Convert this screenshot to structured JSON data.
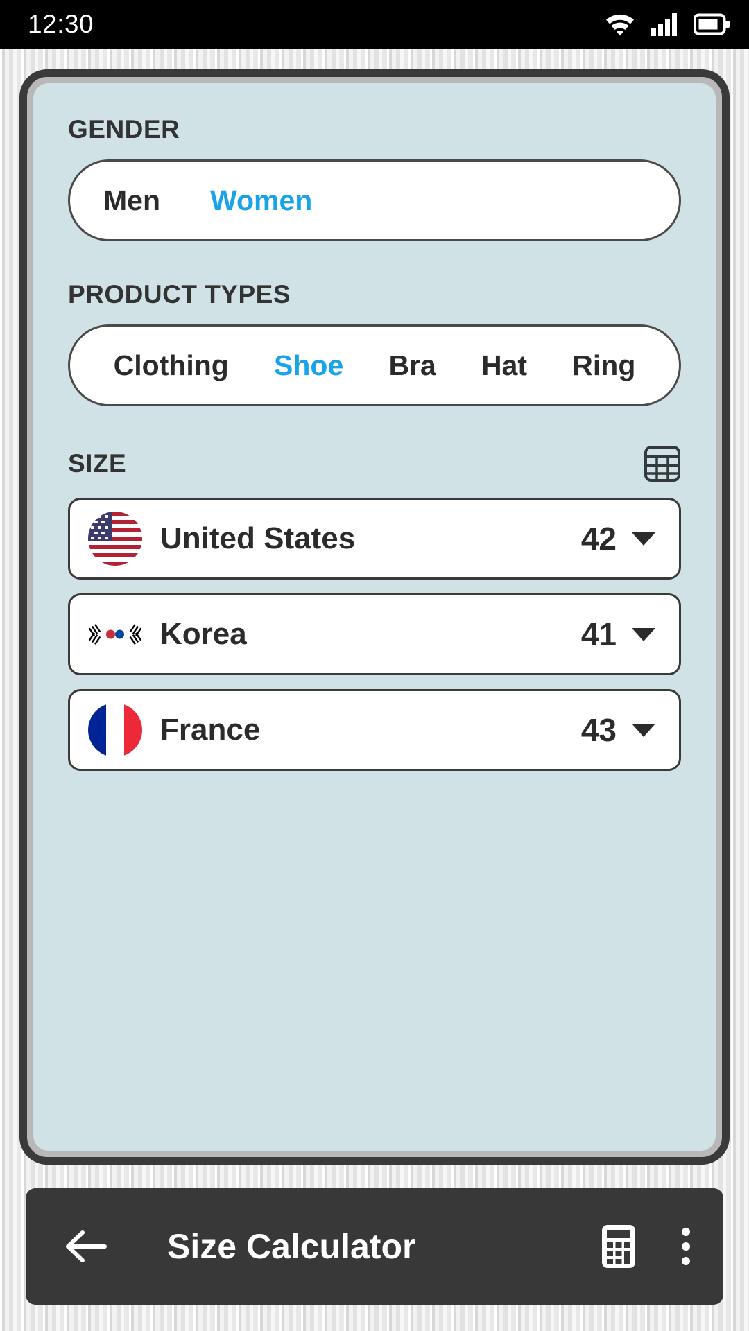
{
  "status_bar": {
    "time": "12:30",
    "icons": [
      "wifi-icon",
      "cellular-signal-icon",
      "battery-icon"
    ]
  },
  "app": {
    "colors": {
      "accent": "#1aa3e8",
      "screen_background": "#d0e2e6",
      "frame": "#3a3a3a",
      "toolbar": "#383838",
      "text": "#2b2b2b"
    },
    "gender": {
      "label": "GENDER",
      "options": [
        {
          "label": "Men",
          "selected": false
        },
        {
          "label": "Women",
          "selected": true
        }
      ]
    },
    "product_types": {
      "label": "PRODUCT TYPES",
      "options": [
        {
          "label": "Clothing",
          "selected": false
        },
        {
          "label": "Shoe",
          "selected": true
        },
        {
          "label": "Bra",
          "selected": false
        },
        {
          "label": "Hat",
          "selected": false
        },
        {
          "label": "Ring",
          "selected": false
        }
      ]
    },
    "size": {
      "label": "SIZE",
      "table_icon": "size-table-icon",
      "rows": [
        {
          "country": "United States",
          "flag": "flag-us",
          "value": "42",
          "caret": "chevron-down-icon"
        },
        {
          "country": "Korea",
          "flag": "flag-kr",
          "value": "41",
          "caret": "chevron-down-icon"
        },
        {
          "country": "France",
          "flag": "flag-fr",
          "value": "43",
          "caret": "chevron-down-icon"
        }
      ]
    }
  },
  "toolbar": {
    "back_icon": "back-arrow-icon",
    "title": "Size Calculator",
    "calculator_icon": "calculator-icon",
    "overflow_icon": "more-vertical-icon"
  }
}
